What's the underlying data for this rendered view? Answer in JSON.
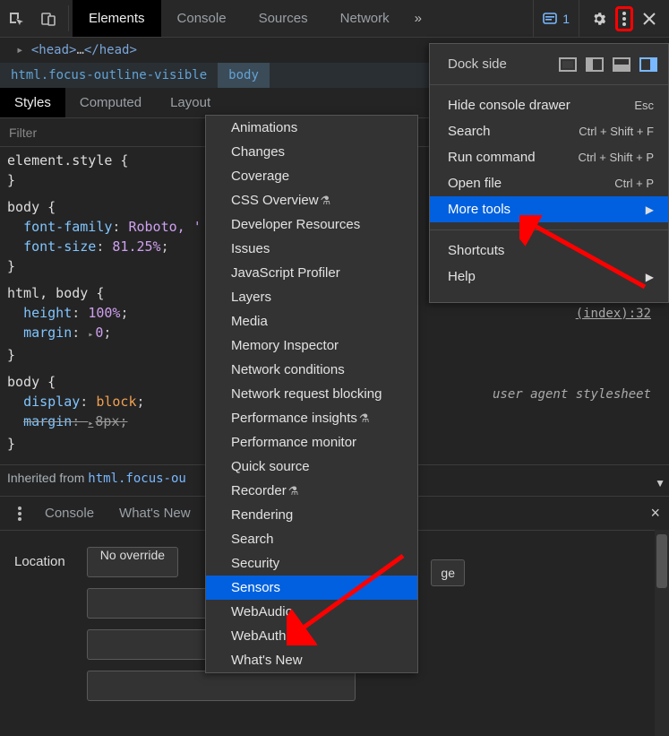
{
  "toolbar": {
    "tabs": [
      "Elements",
      "Console",
      "Sources",
      "Network"
    ],
    "active_tab": "Elements",
    "overflow": "»",
    "issues_count": "1"
  },
  "elements_line": {
    "open": "<head>",
    "dots": "…",
    "close": "</head>"
  },
  "breadcrumbs": [
    "html.focus-outline-visible",
    "body"
  ],
  "styles_tabs": [
    "Styles",
    "Computed",
    "Layout"
  ],
  "filter_placeholder": "Filter",
  "rules": {
    "r0_sel": "element.style",
    "r1_sel": "body",
    "r1_p1": "font-family",
    "r1_v1": "Roboto, '",
    "r1_p2": "font-size",
    "r1_v2": "81.25%",
    "r2_sel": "html, body",
    "r2_p1": "height",
    "r2_v1": "100%",
    "r2_p2": "margin",
    "r2_v2": "0",
    "r3_sel": "body",
    "r3_p1": "display",
    "r3_v1": "block",
    "r3_p2": "margin",
    "r3_v2": "8px"
  },
  "source_link": "(index):32",
  "uas_label": "user agent stylesheet",
  "inherited_label": "Inherited from ",
  "inherited_link": "html.focus-ou",
  "drawer": {
    "tabs": [
      "Console",
      "What's New"
    ],
    "location_label": "Location",
    "no_override": "No override",
    "manage_stub": "ge"
  },
  "menu": {
    "dock_label": "Dock side",
    "hide_drawer": "Hide console drawer",
    "hide_drawer_sc": "Esc",
    "search": "Search",
    "search_sc": "Ctrl + Shift + F",
    "run": "Run command",
    "run_sc": "Ctrl + Shift + P",
    "open": "Open file",
    "open_sc": "Ctrl + P",
    "more_tools": "More tools",
    "shortcuts": "Shortcuts",
    "help": "Help"
  },
  "submenu": [
    "Animations",
    "Changes",
    "Coverage",
    "CSS Overview",
    "Developer Resources",
    "Issues",
    "JavaScript Profiler",
    "Layers",
    "Media",
    "Memory Inspector",
    "Network conditions",
    "Network request blocking",
    "Performance insights",
    "Performance monitor",
    "Quick source",
    "Recorder",
    "Rendering",
    "Search",
    "Security",
    "Sensors",
    "WebAudio",
    "WebAuthn",
    "What's New"
  ],
  "submenu_flask_indices": [
    3,
    12,
    15
  ],
  "submenu_highlight": "Sensors"
}
